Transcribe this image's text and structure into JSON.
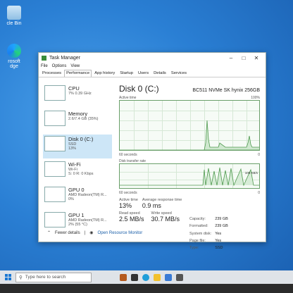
{
  "desktop": {
    "icons": [
      {
        "label": "cle Bin"
      },
      {
        "label": "Microsoft Edge",
        "label_lines": [
          "rosoft",
          "dge"
        ]
      }
    ]
  },
  "window": {
    "title": "Task Manager",
    "menu": [
      "File",
      "Options",
      "View"
    ],
    "tabs": [
      "Processes",
      "Performance",
      "App history",
      "Startup",
      "Users",
      "Details",
      "Services"
    ],
    "active_tab": "Performance"
  },
  "sidebar": {
    "items": [
      {
        "name": "CPU",
        "sub1": "7% 0.39 GHz",
        "sub2": ""
      },
      {
        "name": "Memory",
        "sub1": "2.6/7.4 GB (35%)",
        "sub2": ""
      },
      {
        "name": "Disk 0 (C:)",
        "sub1": "SSD",
        "sub2": "13%"
      },
      {
        "name": "Wi-Fi",
        "sub1": "Wi-Fi",
        "sub2": "S: 0 R: 0 Kbps"
      },
      {
        "name": "GPU 0",
        "sub1": "AMD Radeon(TM) R...",
        "sub2": "0%"
      },
      {
        "name": "GPU 1",
        "sub1": "AMD Radeon(TM) R...",
        "sub2": "2% (55 °C)"
      }
    ]
  },
  "main": {
    "title": "Disk 0 (C:)",
    "model": "BC511 NVMe SK hynix 256GB",
    "graph1": {
      "label": "Active time",
      "max": "100%",
      "time": "60 seconds",
      "min": "0"
    },
    "graph2": {
      "label": "Disk transfer rate",
      "max": "",
      "tag": "100 KB/s",
      "time": "60 seconds",
      "min": "0"
    },
    "stats": {
      "active_time_label": "Active time",
      "active_time": "13%",
      "resp_label": "Average response time",
      "resp": "0.9 ms",
      "read_label": "Read speed",
      "read": "2.5 MB/s",
      "write_label": "Write speed",
      "write": "30.7 MB/s"
    },
    "info": [
      {
        "k": "Capacity:",
        "v": "239 GB"
      },
      {
        "k": "Formatted:",
        "v": "239 GB"
      },
      {
        "k": "System disk:",
        "v": "Yes"
      },
      {
        "k": "Page file:",
        "v": "Yes"
      },
      {
        "k": "Type:",
        "v": "SSD"
      }
    ]
  },
  "footer": {
    "fewer": "Fewer details",
    "monitor": "Open Resource Monitor"
  },
  "taskbar": {
    "search_placeholder": "Type here to search"
  }
}
